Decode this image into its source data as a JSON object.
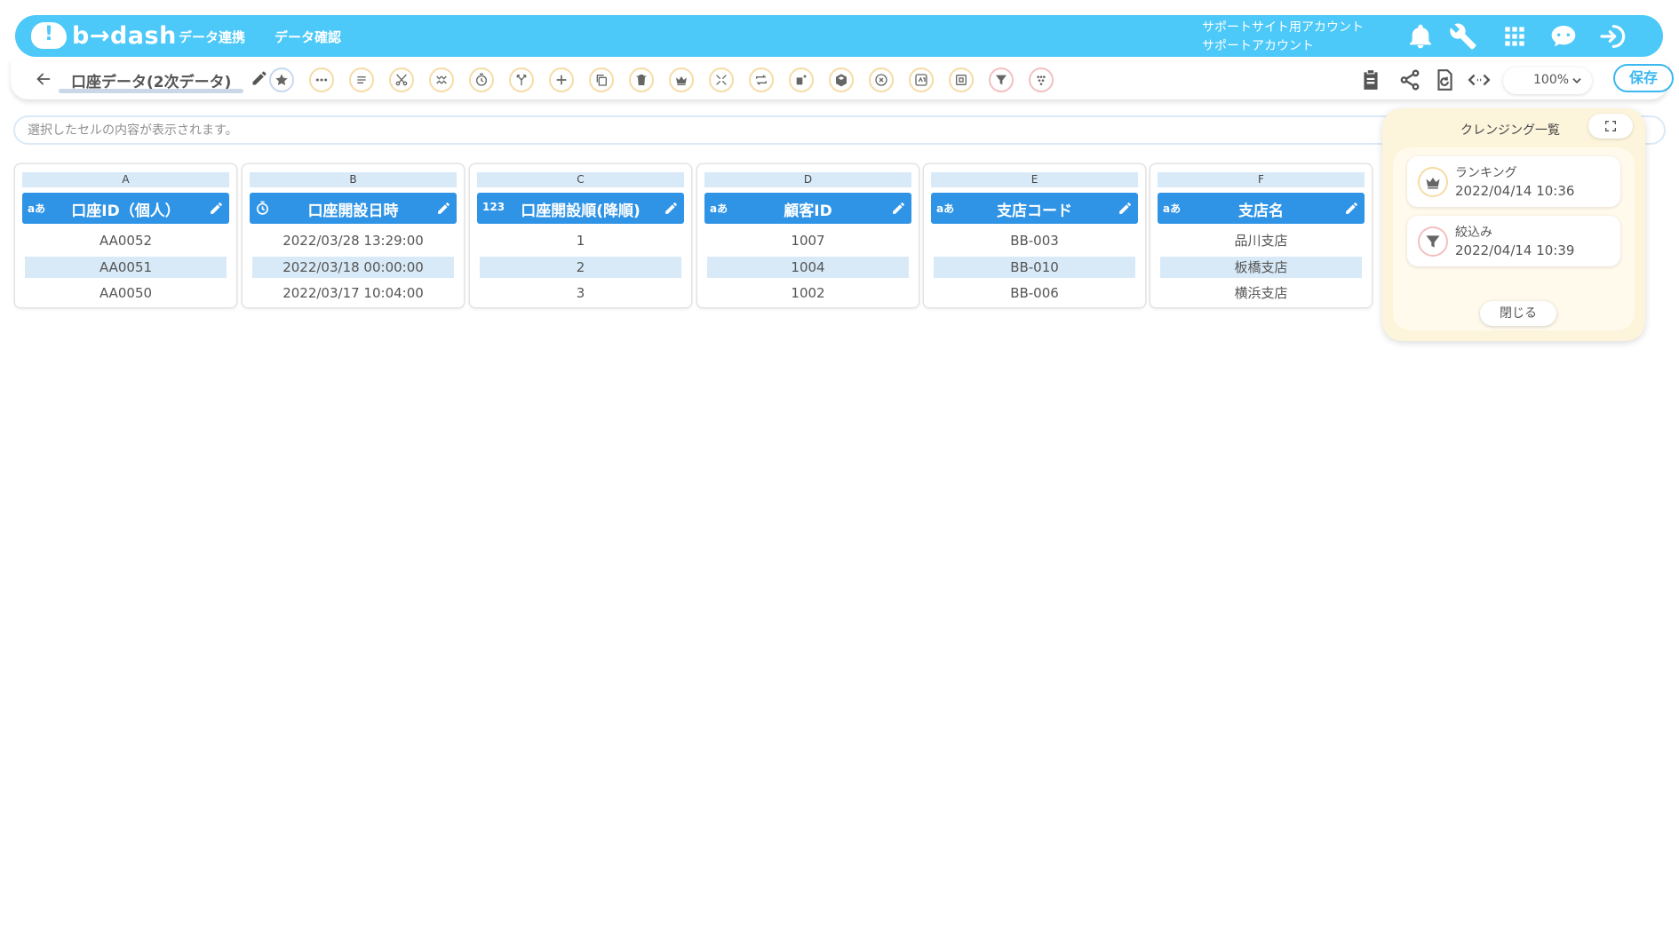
{
  "header": {
    "logo_text": "b→dash",
    "nav": [
      "データ連携",
      "データ確認"
    ],
    "account_line1": "サポートサイト用アカウント",
    "account_line2": "サポートアカウント",
    "icons": [
      "bell-icon",
      "wrench-icon",
      "grid-icon",
      "chat-bot-icon",
      "logout-icon"
    ],
    "brand_color": "#4cc9f8"
  },
  "toolbar": {
    "title": "口座データ(2次データ)",
    "tools": [
      "star-icon",
      "more-icon",
      "list-icon",
      "scissors-icon",
      "merge-columns-icon",
      "timer-icon",
      "split-icon",
      "add-icon",
      "copy-icon",
      "delete-icon",
      "crown-icon",
      "collapse-icon",
      "repeat-icon",
      "calculate-icon",
      "bucket-icon",
      "cancel-icon",
      "convert-icon",
      "box-icon",
      "filter-icon",
      "dedupe-icon"
    ],
    "right_icons": [
      "clipboard-icon",
      "share-icon",
      "refresh-file-icon",
      "code-icon"
    ],
    "zoom": "100%",
    "save_label": "保存"
  },
  "cellbar": {
    "placeholder": "選択したセルの内容が表示されます。"
  },
  "columns": [
    {
      "letter": "A",
      "type": "aあ",
      "name": "口座ID（個人）",
      "cells": [
        "AA0052",
        "AA0051",
        "AA0050"
      ]
    },
    {
      "letter": "B",
      "type": "timer",
      "name": "口座開設日時",
      "cells": [
        "2022/03/28 13:29:00",
        "2022/03/18 00:00:00",
        "2022/03/17 10:04:00"
      ]
    },
    {
      "letter": "C",
      "type": "123",
      "name": "口座開設順(降順)",
      "cells": [
        "1",
        "2",
        "3"
      ]
    },
    {
      "letter": "D",
      "type": "aあ",
      "name": "顧客ID",
      "cells": [
        "1007",
        "1004",
        "1002"
      ]
    },
    {
      "letter": "E",
      "type": "aあ",
      "name": "支店コード",
      "cells": [
        "BB-003",
        "BB-010",
        "BB-006"
      ]
    },
    {
      "letter": "F",
      "type": "aあ",
      "name": "支店名",
      "cells": [
        "品川支店",
        "板橋支店",
        "横浜支店"
      ]
    }
  ],
  "panel": {
    "title": "クレンジング一覧",
    "history": [
      {
        "icon": "crown-icon",
        "label": "ランキング",
        "time": "2022/04/14 10:36"
      },
      {
        "icon": "filter-icon",
        "label": "絞込み",
        "time": "2022/04/14 10:39"
      }
    ],
    "close_label": "閉じる"
  }
}
